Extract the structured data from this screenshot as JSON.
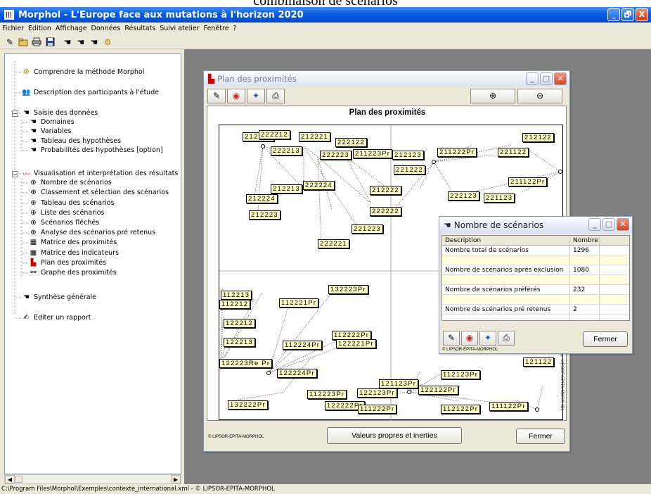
{
  "caption": "combinaison de scénarios",
  "app": {
    "title": "Morphol  -  L'Europe face aux mutations à l'horizon 2020",
    "window_buttons": [
      "_",
      "🗗",
      "X"
    ]
  },
  "menu": [
    "Fichier",
    "Edition",
    "Affichage",
    "Données",
    "Résultats",
    "Suivi atelier",
    "Fenêtre",
    "?"
  ],
  "toolbar_icons": [
    "wand-icon",
    "folder-icon",
    "print-icon",
    "save-icon",
    "hand-icon",
    "hand-icon",
    "hand-icon",
    "help-icon"
  ],
  "tree": {
    "items": [
      {
        "label": "Comprendre la méthode Morphol",
        "icon": "help-icon"
      },
      {
        "label": "Description des participants à l'étude",
        "icon": "people-icon"
      },
      {
        "label": "Saisie des données",
        "icon": "hand-icon"
      },
      {
        "label": "Domaines",
        "icon": "hand-icon"
      },
      {
        "label": "Variables",
        "icon": "hand-icon"
      },
      {
        "label": "Tableau des hypothèses",
        "icon": "hand-icon"
      },
      {
        "label": "Probabilités des hypothèses [option]",
        "icon": "hand-icon"
      },
      {
        "label": "Visualisation et interprétation des résultats",
        "icon": "chart-icon"
      },
      {
        "label": "Nombre de scénarios",
        "icon": "target-icon"
      },
      {
        "label": "Classement et sélection des scénarios",
        "icon": "target-icon"
      },
      {
        "label": "Tableau des scénarios",
        "icon": "target-icon"
      },
      {
        "label": "Liste des scénarios",
        "icon": "target-icon"
      },
      {
        "label": "Scénarios fléchés",
        "icon": "target-icon"
      },
      {
        "label": "Analyse des scénarios pré retenus",
        "icon": "target-icon"
      },
      {
        "label": "Matrice des proximités",
        "icon": "matrix-icon"
      },
      {
        "label": "Matrice des indicateurs",
        "icon": "matrix-icon"
      },
      {
        "label": "Plan des proximités",
        "icon": "plan-icon"
      },
      {
        "label": "Graphe des proximités",
        "icon": "graph-icon"
      },
      {
        "label": "Synthèse générale",
        "icon": "hand-icon"
      },
      {
        "label": "Editer un rapport",
        "icon": "report-icon"
      }
    ]
  },
  "status": "C:\\Program Files\\Morphol\\Exemples\\contexte_international.xml  - © LIPSOR-EPITA-MORPHOL",
  "prox_window": {
    "title": "Plan des proximités",
    "plot_title": "Plan des proximités",
    "copyright": "© LIPSOR-EPITA-MORPHOL",
    "side_text": "© LIPSOR-EPITA-MORPHOL",
    "btn_values": "Valeurs propres et inerties",
    "btn_close": "Fermer",
    "labels": [
      "212222",
      "222212",
      "212221",
      "222122",
      "222213",
      "222223",
      "211223Pr",
      "212123",
      "211222Pr",
      "221122",
      "212122",
      "221222",
      "212213",
      "222224",
      "212222",
      "212224",
      "212223",
      "222222",
      "221223",
      "222221",
      "222123",
      "221123",
      "211122Pr",
      "132223Pr",
      "112213",
      "112212",
      "112221Pr",
      "122212",
      "122213",
      "112222Pr",
      "112224Pr",
      "122221Pr",
      "122223Re Pr",
      "122224Pr",
      "121123Pr",
      "112123Pr",
      "122122Pr",
      "112223Pr",
      "122123Pr",
      "132222Pr",
      "122222Pr",
      "111222Pr",
      "112122Pr",
      "111122Pr",
      "121122"
    ]
  },
  "nb_window": {
    "title": "Nombre de scénarios",
    "col_description": "Description",
    "col_nombre": "Nombre",
    "rows": [
      {
        "desc": "Nombre total de scénarios",
        "value": "1296"
      },
      {
        "desc": "Nombre de scénarios après exclusion",
        "value": "1080"
      },
      {
        "desc": "Nombre de scénarios préférés",
        "value": "232"
      },
      {
        "desc": "Nombre de scénarios pré retenus",
        "value": "2"
      }
    ],
    "copyright": "© LIPSOR-EPITA-MORPHOL",
    "btn_close": "Fermer"
  }
}
